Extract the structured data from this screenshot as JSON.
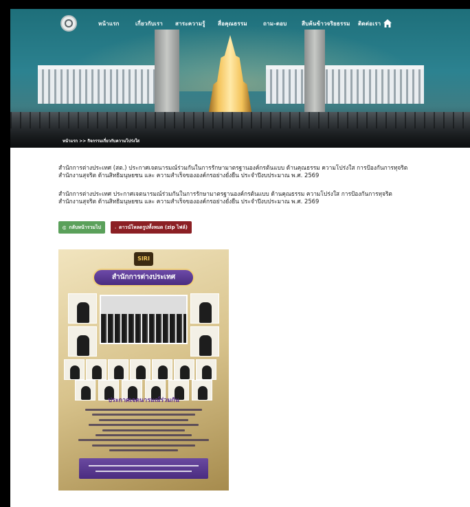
{
  "nav": {
    "items": [
      {
        "label": "หน้าแรก"
      },
      {
        "label": "เกี่ยวกับเรา"
      },
      {
        "label": "สาระความรู้"
      },
      {
        "label": "สื่อคุณธรรม"
      },
      {
        "label": "ถาม-ตอบ"
      },
      {
        "label": "สืบค้นข้าวจริยธรรม"
      },
      {
        "label": "ติดต่อเรา"
      }
    ]
  },
  "breadcrumb": {
    "text": "หน้าแรก >> กิจกรรมเกี่ยวกับความโปร่งใส"
  },
  "content": {
    "paragraph1_line1": "สำนักการต่างประเทศ (สต.) ประกาศเจตนารมณ์ร่วมกันในการรักษามาตรฐานองค์กรต้นแบบ ด้านคุณธรรม ความโปร่งใส การป้องกันการทุจริต",
    "paragraph1_line2": "สำนักงานสุจริต ด้านสิทธิมนุษยชน และ ความสำเร็จขององค์กรอย่างยั่งยืน ประจำปีงบประมาณ พ.ศ. 2569",
    "paragraph2_line1": "สำนักการต่างประเทศ ประกาศเจตนารมณ์ร่วมกันในการรักษามาตรฐานองค์กรต้นแบบ ด้านคุณธรรม ความโปร่งใส การป้องกันการทุจริต",
    "paragraph2_line2": "สำนักงานสุจริต ด้านสิทธิมนุษยชน และ ความสำเร็จขององค์กรอย่างยั่งยืน ประจำปีงบประมาณ พ.ศ. 2569"
  },
  "buttons": {
    "back_label": "กลับหน้ารวมไป",
    "download_label": "ดาวน์โหลดรูปทั้งหมด (zip ไฟล์)"
  },
  "poster": {
    "seal_text": "SIRI",
    "banner_title": "สำนักการต่างประเทศ",
    "announcement_title": "ประกาศเจตนารมณ์ร่วมกัน"
  },
  "colors": {
    "back_button": "#5aa05a",
    "download_button": "#8b1f24",
    "poster_accent": "#5a2d8a"
  }
}
